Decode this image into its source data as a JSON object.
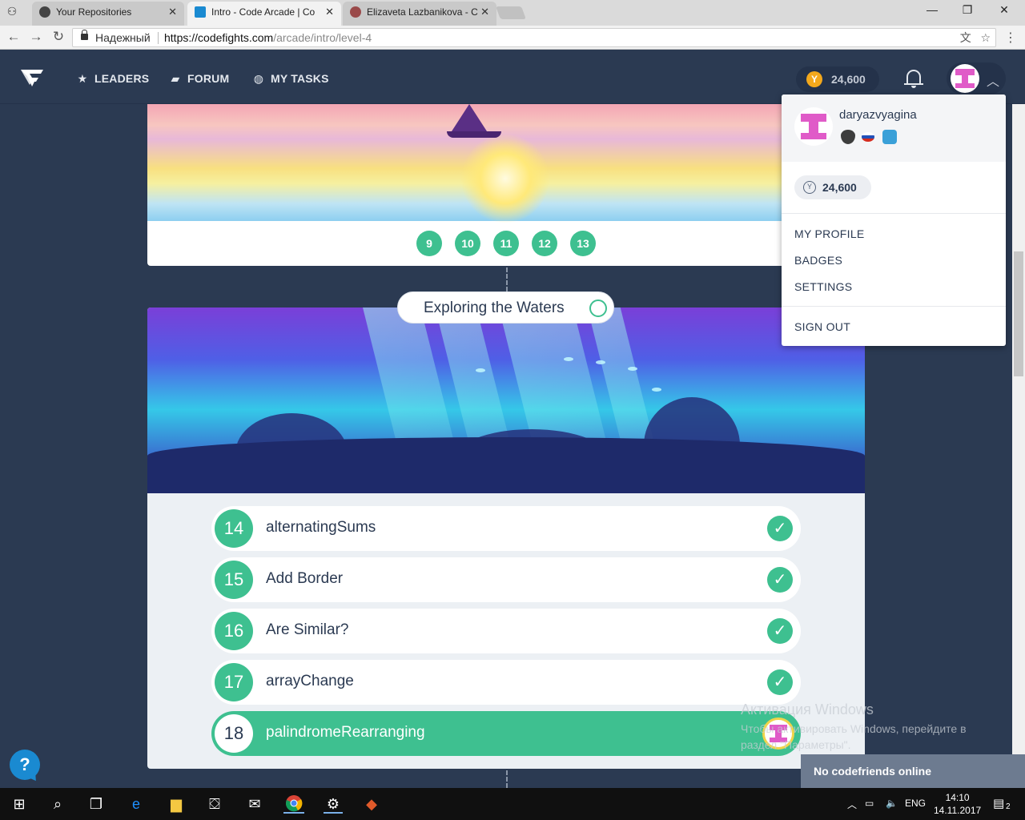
{
  "browser": {
    "tabs": [
      {
        "label": "Your Repositories"
      },
      {
        "label": "Intro - Code Arcade | Co"
      },
      {
        "label": "Elizaveta Lazbanikova - C"
      }
    ],
    "secure_label": "Надежный",
    "url_prefix": "https://",
    "url_host": "codefights.com",
    "url_path": "/arcade/intro/level-4"
  },
  "nav": {
    "leaders": "LEADERS",
    "forum": "FORUM",
    "my_tasks": "MY TASKS",
    "coins": "24,600"
  },
  "top_card": {
    "levels": [
      "9",
      "10",
      "11",
      "12",
      "13"
    ]
  },
  "section": {
    "title": "Exploring the Waters"
  },
  "tasks": [
    {
      "num": "14",
      "name": "alternatingSums",
      "done": true
    },
    {
      "num": "15",
      "name": "Add Border",
      "done": true
    },
    {
      "num": "16",
      "name": "Are Similar?",
      "done": true
    },
    {
      "num": "17",
      "name": "arrayChange",
      "done": true
    },
    {
      "num": "18",
      "name": "palindromeRearranging",
      "done": false
    }
  ],
  "dropdown": {
    "username": "daryazvyagina",
    "coins": "24,600",
    "items": [
      "MY PROFILE",
      "BADGES",
      "SETTINGS"
    ],
    "sign_out": "SIGN OUT"
  },
  "overlay": {
    "help": "?",
    "watermark_title": "Активация Windows",
    "watermark_text": "Чтобы активировать Windows, перейдите в раздел \"Параметры\".",
    "friends": "No codefriends online"
  },
  "taskbar": {
    "lang": "ENG",
    "time": "14:10",
    "date": "14.11.2017",
    "notif_count": "2"
  },
  "colors": {
    "accent_green": "#3ec090",
    "header_bg": "#2b3a52",
    "coin_gold": "#f3a81c"
  }
}
